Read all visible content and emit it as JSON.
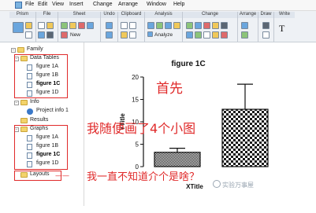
{
  "menu": [
    "File",
    "Edit",
    "View",
    "Insert",
    "Change",
    "Arrange",
    "Window",
    "Help"
  ],
  "ribbon": {
    "groups": [
      "Prism",
      "File",
      "Sheet",
      "Undo",
      "Clipboard",
      "Analysis",
      "Change",
      "Arrange",
      "Draw",
      "Write"
    ],
    "new_label": "New",
    "analyze_label": "Analyze",
    "text_tool": "T"
  },
  "navigator": {
    "family": "Family",
    "data_tables": "Data Tables",
    "data_items": [
      "figure 1A",
      "figure 1B",
      "figure 1C",
      "figure 1D"
    ],
    "info": "Info",
    "info_items": [
      "Project info 1"
    ],
    "results": "Results",
    "graphs": "Graphs",
    "graph_items": [
      "figure 1A",
      "figure 1B",
      "figure 1C",
      "figure 1D"
    ],
    "layouts": "Layouts",
    "selected": "figure 1C"
  },
  "chart_data": {
    "type": "bar",
    "title": "figure 1C",
    "xlabel": "XTitle",
    "ylabel": "YTitle",
    "ylim": [
      0,
      20
    ],
    "yticks": [
      0,
      5,
      10,
      15,
      20
    ],
    "values": [
      3.2,
      12.8
    ],
    "errors": [
      0.9,
      5.6
    ],
    "patterns": [
      "dense-dots",
      "checkerboard"
    ]
  },
  "annotations": {
    "first": "首先",
    "drew": "我随便画了4个小图",
    "layouts_note": "我一直不知道介个是啥？",
    "arrow": "——"
  },
  "watermark": "实验万事屋",
  "colors": {
    "annotation_red": "#e02a2a",
    "bar_dark": "#1a1a1a",
    "folder_yellow": "#f3d36b"
  }
}
